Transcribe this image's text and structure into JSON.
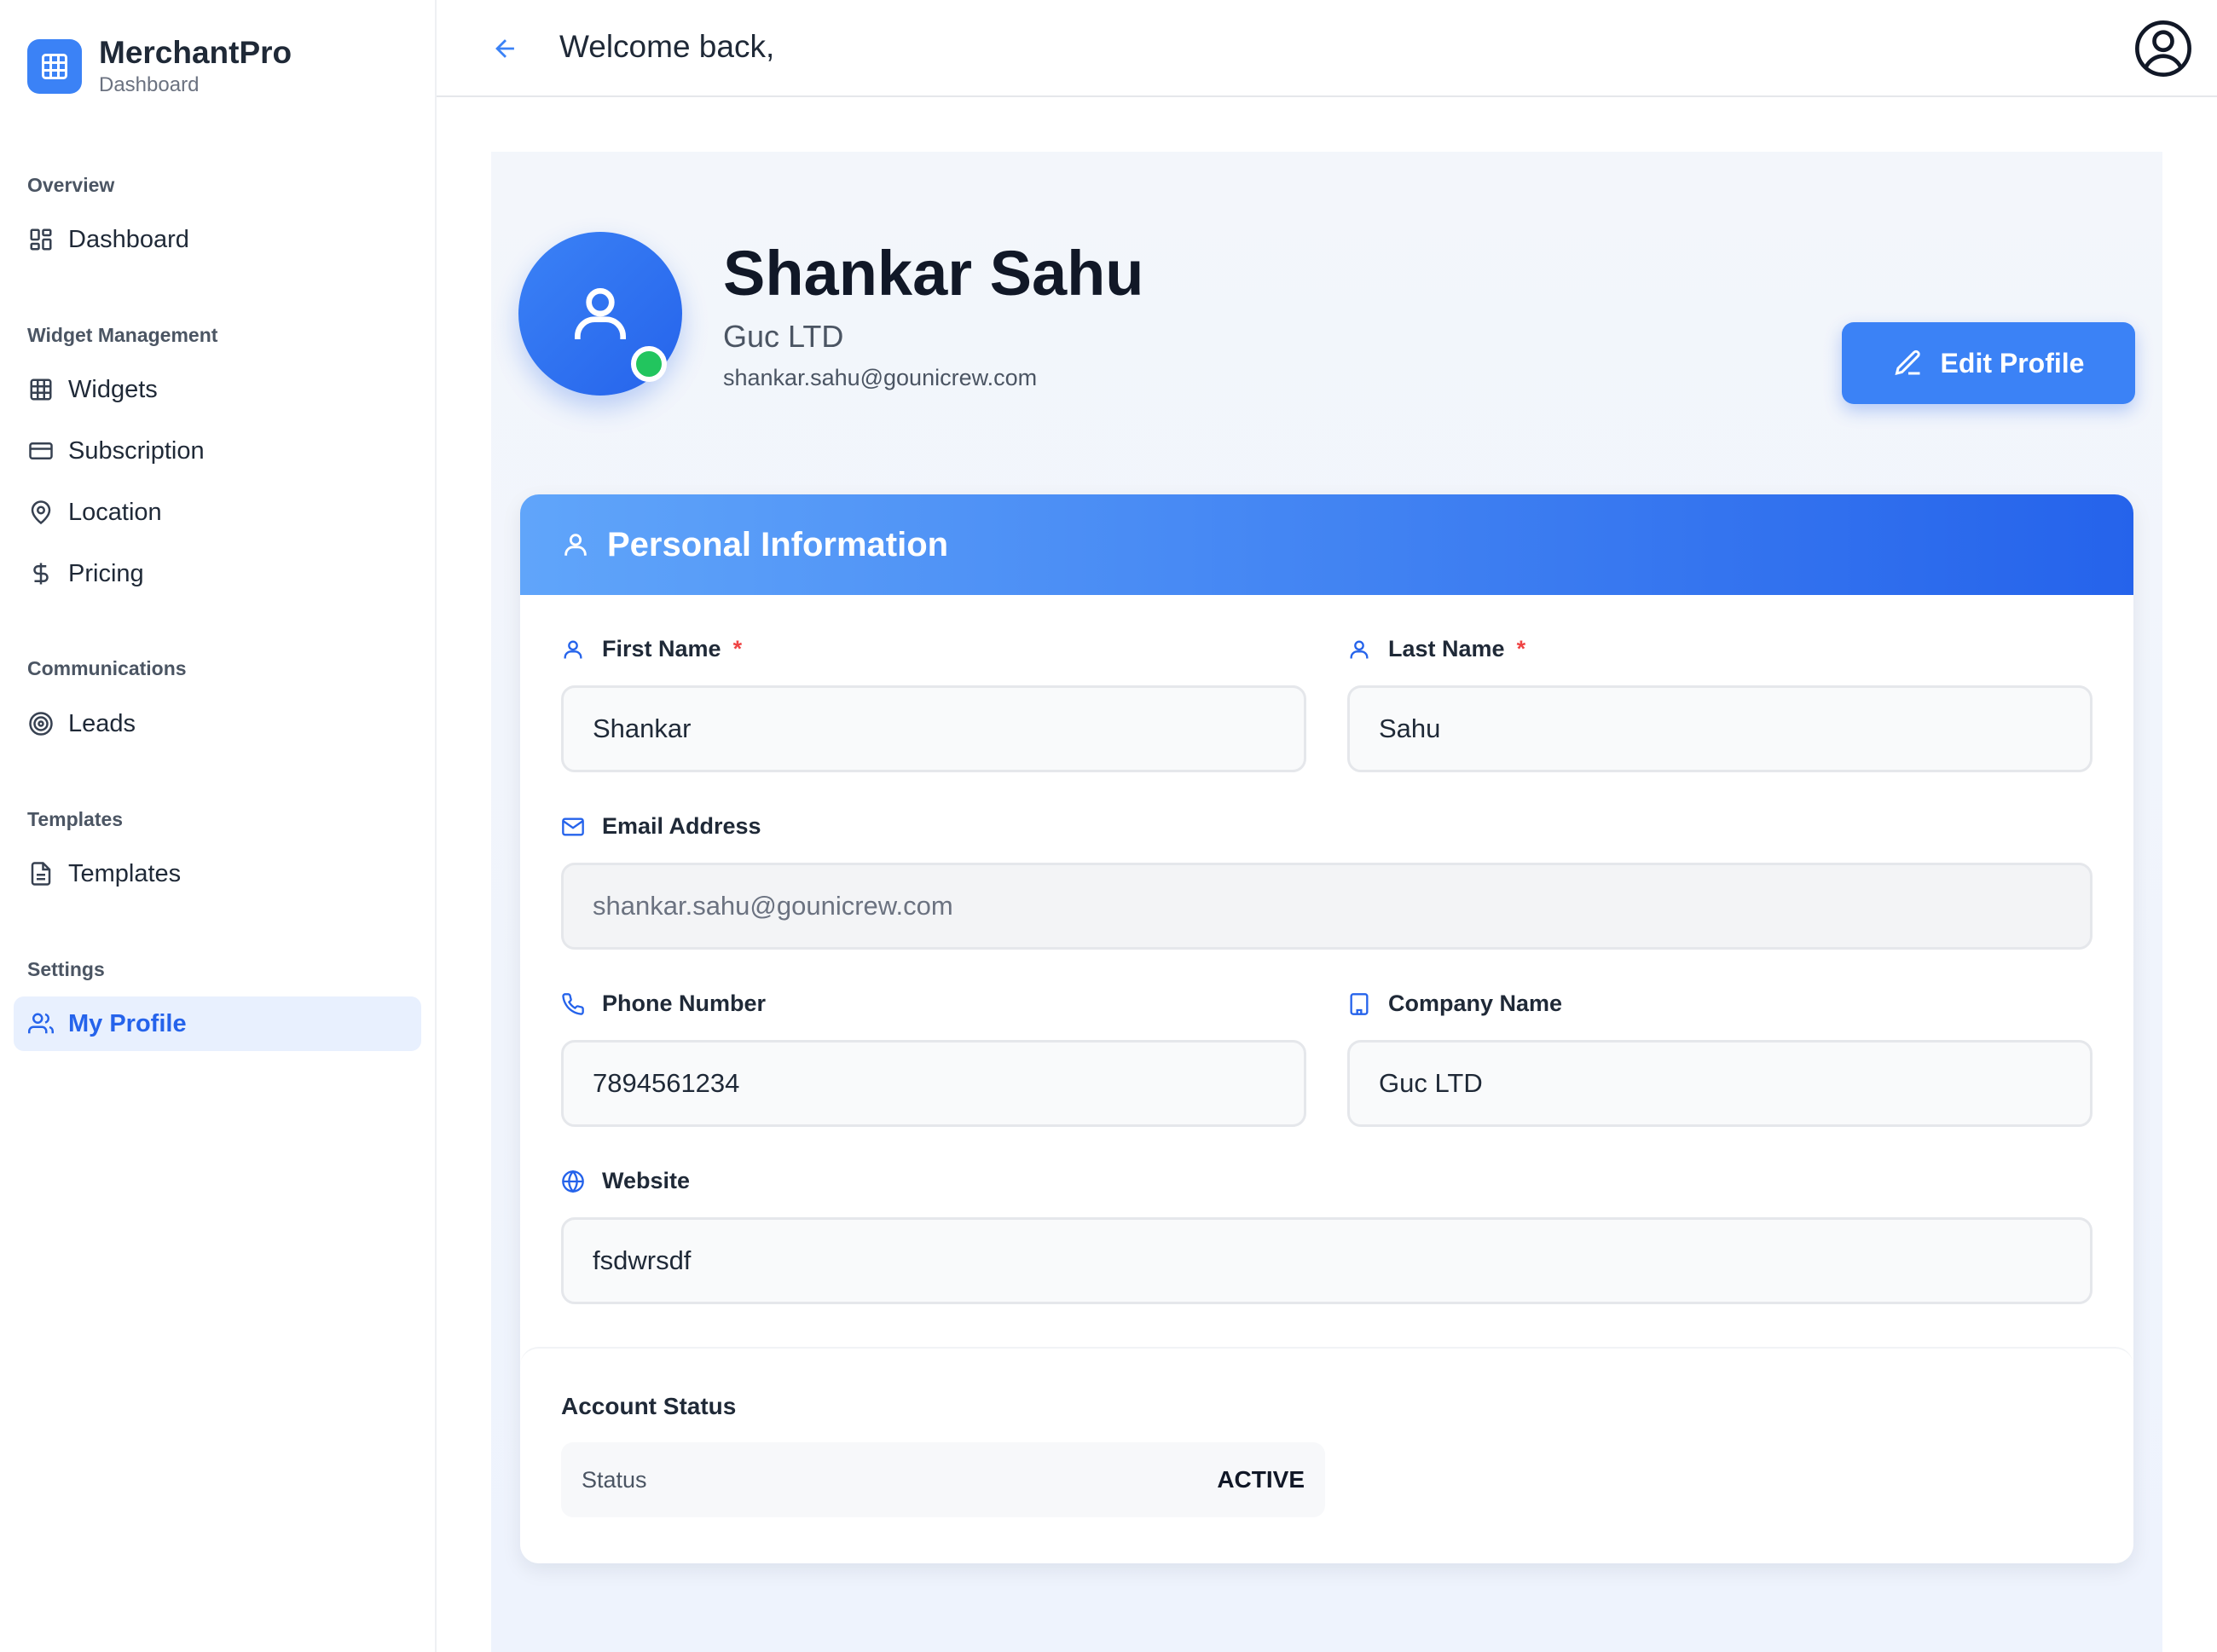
{
  "brand": {
    "name": "MerchantPro",
    "subtitle": "Dashboard"
  },
  "sidebar": {
    "sections": [
      {
        "title": "Overview",
        "items": [
          {
            "label": "Dashboard",
            "icon": "dashboard-grid-icon"
          }
        ]
      },
      {
        "title": "Widget Management",
        "items": [
          {
            "label": "Widgets",
            "icon": "table-grid-icon"
          },
          {
            "label": "Subscription",
            "icon": "credit-card-icon"
          },
          {
            "label": "Location",
            "icon": "map-pin-icon"
          },
          {
            "label": "Pricing",
            "icon": "dollar-icon"
          }
        ]
      },
      {
        "title": "Communications",
        "items": [
          {
            "label": "Leads",
            "icon": "target-icon"
          }
        ]
      },
      {
        "title": "Templates",
        "items": [
          {
            "label": "Templates",
            "icon": "document-icon"
          }
        ]
      },
      {
        "title": "Settings",
        "items": [
          {
            "label": "My Profile",
            "icon": "users-icon",
            "active": true
          }
        ]
      }
    ]
  },
  "header": {
    "welcome": "Welcome back,"
  },
  "profile": {
    "name": "Shankar Sahu",
    "company": "Guc LTD",
    "email": "shankar.sahu@gounicrew.com",
    "edit_label": "Edit Profile",
    "online": true
  },
  "personal_info": {
    "title": "Personal Information",
    "first_name": {
      "label": "First Name",
      "required": "*",
      "value": "Shankar"
    },
    "last_name": {
      "label": "Last Name",
      "required": "*",
      "value": "Sahu"
    },
    "email": {
      "label": "Email Address",
      "value": "shankar.sahu@gounicrew.com"
    },
    "phone": {
      "label": "Phone Number",
      "value": "7894561234"
    },
    "company": {
      "label": "Company Name",
      "value": "Guc LTD"
    },
    "website": {
      "label": "Website",
      "value": "fsdwrsdf"
    }
  },
  "account_status": {
    "title": "Account Status",
    "key": "Status",
    "value": "ACTIVE"
  },
  "colors": {
    "accent": "#3b82f6",
    "accent_dark": "#2563eb",
    "online": "#22c55e",
    "required": "#ef4444"
  }
}
